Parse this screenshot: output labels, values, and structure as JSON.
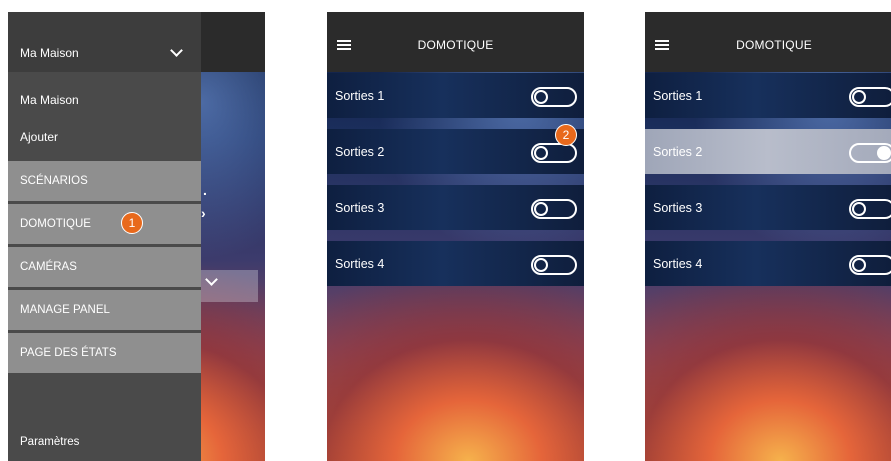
{
  "screen1": {
    "drawer": {
      "home_selector": "Ma Maison",
      "home_item": "Ma Maison",
      "add_item": "Ajouter",
      "menu": [
        "SCÉNARIOS",
        "DOMOTIQUE",
        "CAMÉRAS",
        "MANAGE PANEL",
        "PAGE DES ÉTATS"
      ],
      "settings": "Paramètres"
    },
    "badge": "1"
  },
  "screen2": {
    "title": "DOMOTIQUE",
    "rows": [
      {
        "label": "Sorties 1",
        "state": "off"
      },
      {
        "label": "Sorties 2",
        "state": "off"
      },
      {
        "label": "Sorties 3",
        "state": "off"
      },
      {
        "label": "Sorties 4",
        "state": "off"
      }
    ],
    "badge": "2"
  },
  "screen3": {
    "title": "DOMOTIQUE",
    "rows": [
      {
        "label": "Sorties 1",
        "state": "off"
      },
      {
        "label": "Sorties 2",
        "state": "on"
      },
      {
        "label": "Sorties 3",
        "state": "off"
      },
      {
        "label": "Sorties 4",
        "state": "off"
      }
    ]
  },
  "colors": {
    "badge": "#e8691c",
    "drawer": "#4a4a4a",
    "menu_item": "#8f8f8f",
    "topbar": "#2b2b2b"
  },
  "icons": [
    "hamburger-icon",
    "chevron-down-icon",
    "toggle-switch"
  ]
}
